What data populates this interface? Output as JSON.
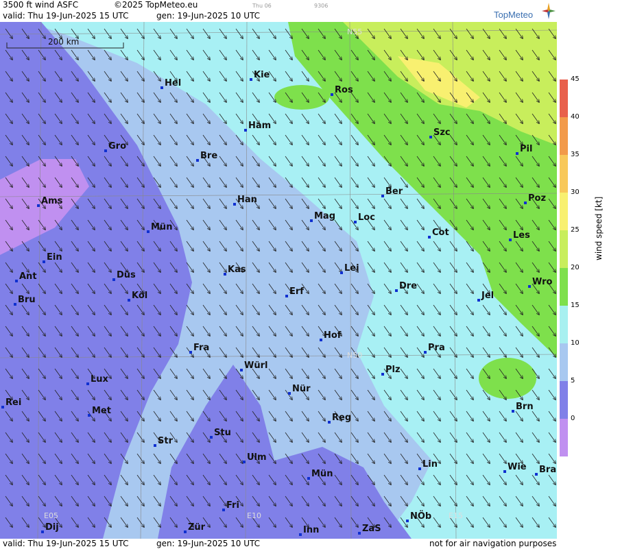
{
  "header": {
    "product": "3500 ft wind ASFC",
    "copyright": "©2025 TopMeteo.eu",
    "valid": "valid:  Thu  19-Jun-2025  15 UTC",
    "gen": "gen: 19-Jun-2025 10 UTC",
    "tiny1": "Thu 06",
    "tiny2": "9306",
    "logo": "TopMeteo"
  },
  "footer": {
    "valid": "valid:  Thu  19-Jun-2025  15 UTC",
    "gen": "gen: 19-Jun-2025 10 UTC",
    "note": "not for air navigation purposes"
  },
  "scale": {
    "label": "200 km"
  },
  "grid_labels": [
    "N55",
    "N50",
    "E05",
    "E10",
    "E15"
  ],
  "cities": [
    "Hel",
    "Kie",
    "Ros",
    "Ham",
    "Szc",
    "Pil",
    "Gro",
    "Bre",
    "Ber",
    "Poz",
    "Ams",
    "Han",
    "Mag",
    "Loc",
    "Cot",
    "Les",
    "Mün",
    "Ein",
    "Kas",
    "Lei",
    "Ant",
    "Düs",
    "Dre",
    "Wro",
    "Köl",
    "Erf",
    "Jel",
    "Bru",
    "Hof",
    "Fra",
    "Pra",
    "Würl",
    "Plz",
    "Lux",
    "Nür",
    "Rei",
    "Met",
    "Reg",
    "Brn",
    "Stu",
    "Str",
    "Ulm",
    "Lin",
    "Wie",
    "Bra",
    "Mün",
    "Fri",
    "NÖb",
    "Dij",
    "Zür",
    "Inn",
    "ZaS"
  ],
  "legend": {
    "title": "wind speed  [kt]",
    "ticks": [
      "45",
      "40",
      "35",
      "30",
      "25",
      "20",
      "15",
      "10",
      "5",
      "0"
    ],
    "colors": [
      "#e8604c",
      "#f29a4a",
      "#f8c85a",
      "#f8f070",
      "#c8ee5c",
      "#7ee04c",
      "#a8f0f0",
      "#a8c8f0",
      "#8080e8",
      "#c090f0"
    ]
  }
}
